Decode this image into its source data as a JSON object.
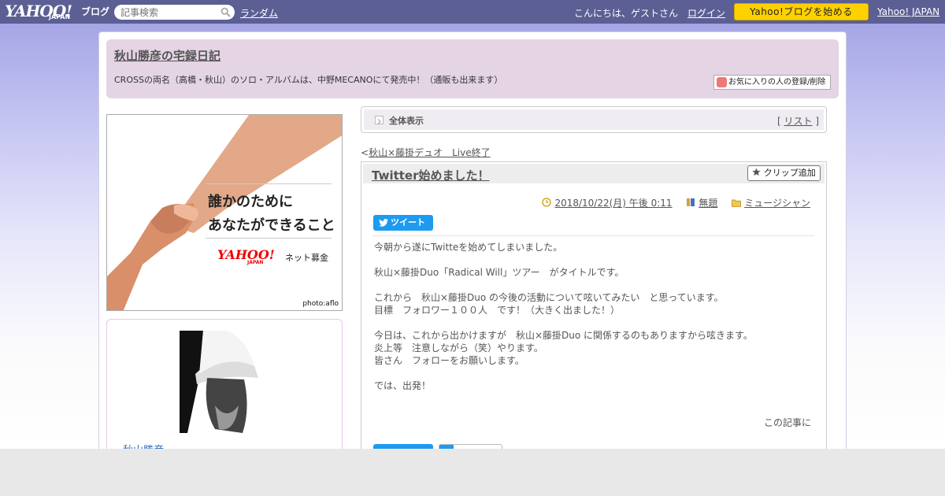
{
  "topbar": {
    "logo_main": "YAHOO!",
    "logo_sub": "JAPAN",
    "logo_blog": "ブログ",
    "search_placeholder": "記事検索",
    "random_link": "ランダム",
    "greeting": "こんにちは、ゲストさん",
    "login_link": "ログイン",
    "start_button": "Yahoo!ブログを始める",
    "yahoo_japan_link": "Yahoo! JAPAN",
    "bar_color": "#5b5f94",
    "button_color": "#ffd100"
  },
  "header": {
    "blog_title": "秋山勝彦の宅録日記",
    "description": "CROSSの両名（高橋・秋山）のソロ・アルバムは、中野MECANOにて発売中！（通販も出来ます）",
    "favorite_button": "お気に入りの人の登録/削除",
    "bg_color": "#e4d4e4"
  },
  "banner": {
    "line1": "誰かのために",
    "line2": "あなたができること",
    "logo_text": "YAHOO!",
    "logo_sub": "JAPAN",
    "tagline": "ネット募金",
    "credit": "photo:aflo"
  },
  "profile": {
    "name": "秋山勝彦"
  },
  "view": {
    "label": "全体表示",
    "list_link_prefix": "[ ",
    "list_link": "リスト",
    "list_link_suffix": " ]"
  },
  "prev_post": {
    "prefix": "<",
    "title": "秋山×藤掛デュオ　Live終了"
  },
  "article": {
    "title": "Twitter始めました！",
    "clip_button": "クリップ追加",
    "date": "2018/10/22(月) 午後 0:11",
    "tag": "無題",
    "category": "ミュージシャン",
    "tweet_button": "ツイート",
    "body": "今朝から遂にTwitteを始めてしまいました。\n\n秋山×藤掛Duo「Radical Will」ツアー　がタイトルです。\n\nこれから　秋山×藤掛Duo の今後の活動について呟いてみたい　と思っています。\n目標　フォロワー１００人　です！（大きく出ました！）\n\n今日は、これから出かけますが　秋山×藤掛Duo に関係するのもありますから呟きます。\n炎上等　注意しながら（笑）やります。\n皆さん　フォローをお願いします。\n\nでは、出発！",
    "footer": "この記事に",
    "accent_color": "#1d9bf0"
  }
}
